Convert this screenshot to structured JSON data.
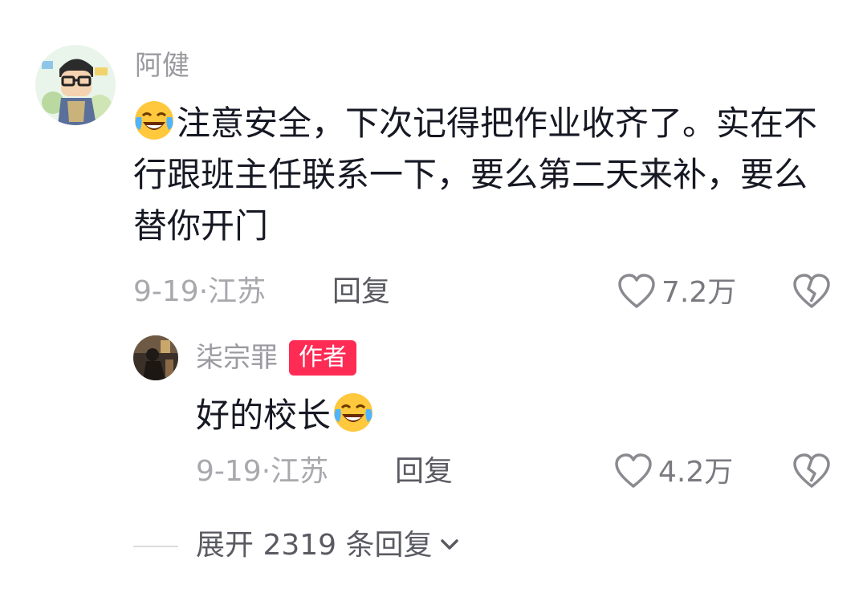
{
  "comment": {
    "username": "阿健",
    "avatar": "cartoon-avatar",
    "emoji": "laugh-cry-emoji",
    "text": "注意安全，下次记得把作业收齐了。实在不行跟班主任联系一下，要么第二天来补，要么替你开门",
    "date": "9-19",
    "location_sep": "·",
    "location": "江苏",
    "reply_label": "回复",
    "like_icon": "heart-icon",
    "like_count": "7.2万",
    "dislike_icon": "broken-heart-icon"
  },
  "reply": {
    "username": "柒宗罪",
    "badge": "作者",
    "avatar": "photo-avatar",
    "text": "好的校长",
    "emoji": "laugh-cry-emoji",
    "date": "9-19",
    "location_sep": "·",
    "location": "江苏",
    "reply_label": "回复",
    "like_icon": "heart-icon",
    "like_count": "4.2万",
    "dislike_icon": "broken-heart-icon"
  },
  "expand": {
    "label": "展开 2319 条回复",
    "icon": "chevron-down-icon"
  },
  "colors": {
    "badge": "#fe2c55",
    "text": "#161823",
    "muted": "#a8a8ad"
  }
}
